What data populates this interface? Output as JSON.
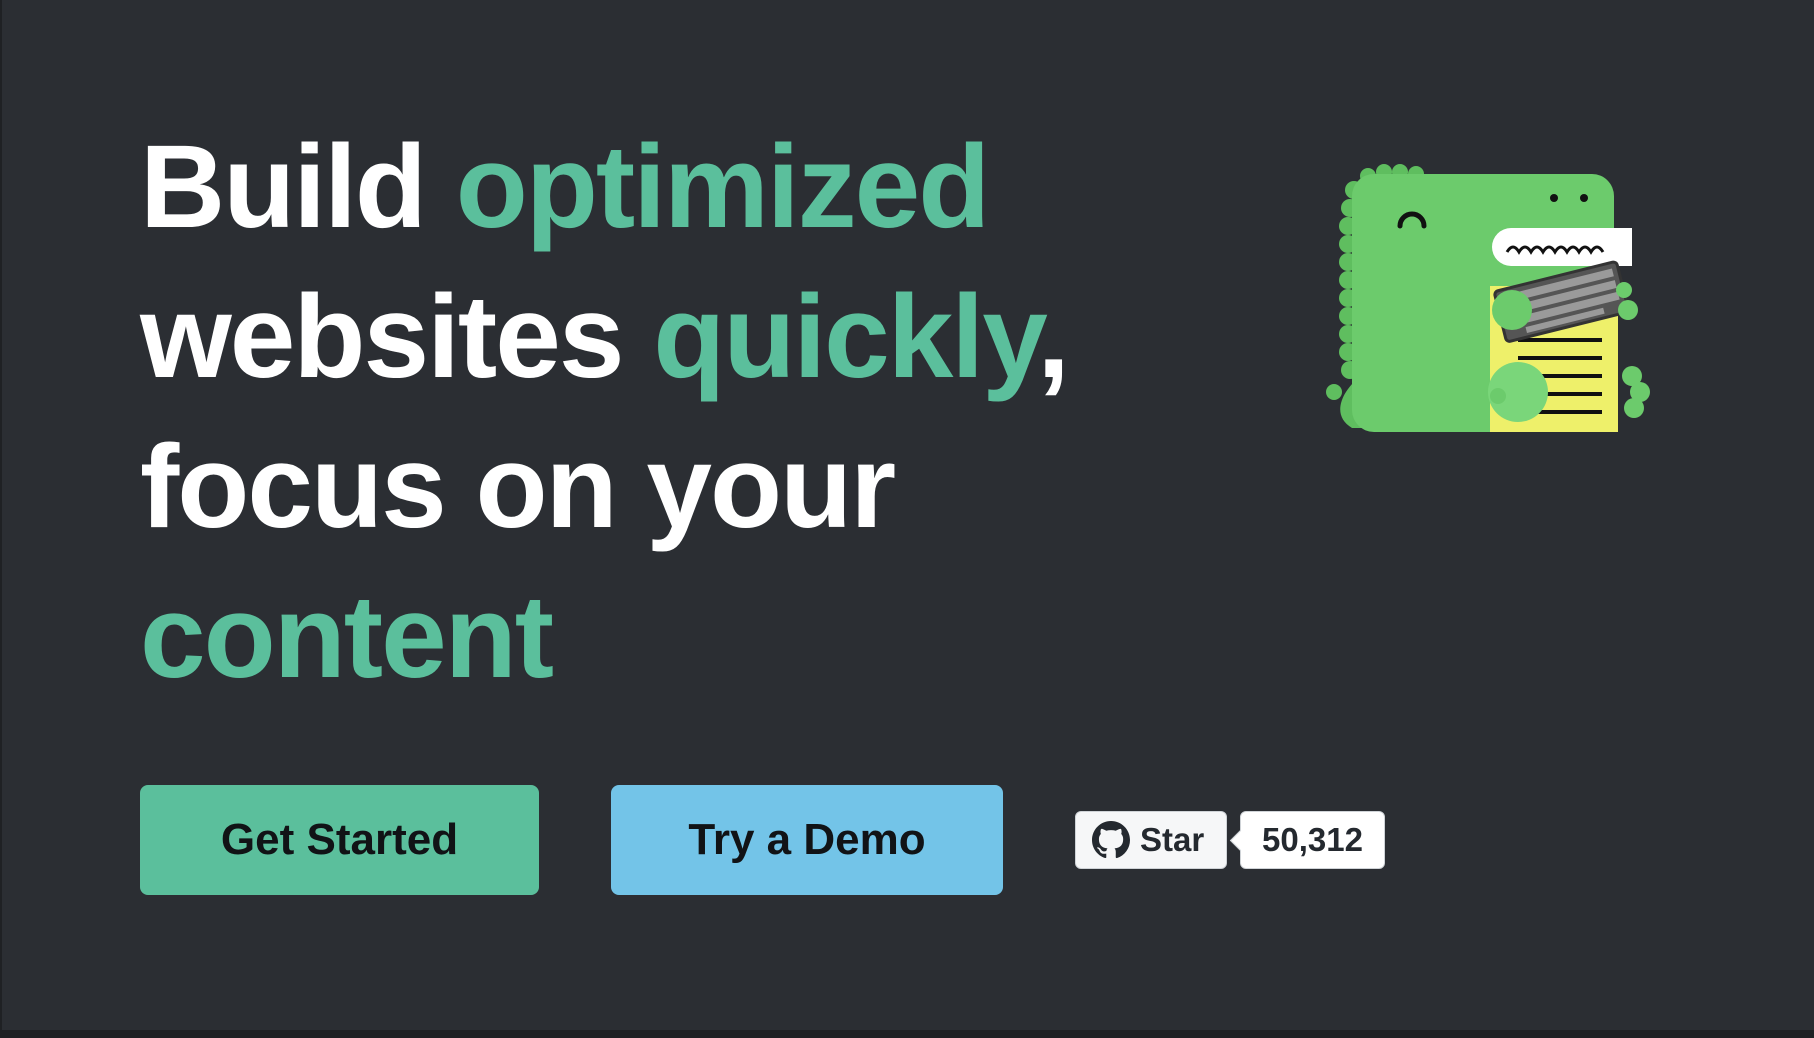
{
  "hero": {
    "headline": {
      "line1": {
        "a": "Build ",
        "b": "optimized"
      },
      "line2": {
        "a": "websites ",
        "b": "quickly",
        "c": ","
      },
      "line3": {
        "a": "focus on your"
      },
      "line4": {
        "b": "content"
      }
    },
    "colors": {
      "background": "#2b2e33",
      "accent": "#5bbf9c",
      "text": "#ffffff",
      "demo_button": "#73c4e8"
    },
    "buttons": {
      "get_started": "Get Started",
      "try_demo": "Try a Demo"
    },
    "github": {
      "star_label": "Star",
      "star_count": "50,312",
      "icon": "github-octocat-icon"
    },
    "mascot": {
      "icon": "dinosaur-mascot-icon"
    }
  }
}
